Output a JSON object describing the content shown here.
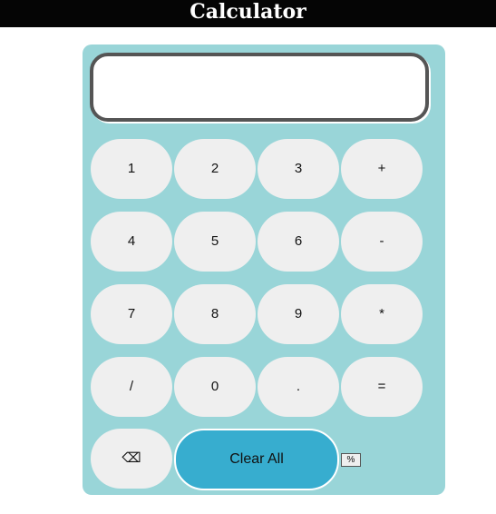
{
  "header": {
    "title": "Calculator"
  },
  "display": {
    "value": ""
  },
  "keys": {
    "k1": "1",
    "k2": "2",
    "k3": "3",
    "plus": "+",
    "k4": "4",
    "k5": "5",
    "k6": "6",
    "minus": "-",
    "k7": "7",
    "k8": "8",
    "k9": "9",
    "multiply": "*",
    "divide": "/",
    "k0": "0",
    "dot": ".",
    "equals": "=",
    "backspace": "⌫"
  },
  "clear_all": "Clear All",
  "percent": "%",
  "colors": {
    "header_bg": "#050505",
    "panel_bg": "#99d5d8",
    "key_bg": "#efefef",
    "clear_bg": "#37adcf",
    "display_border": "#555555"
  }
}
